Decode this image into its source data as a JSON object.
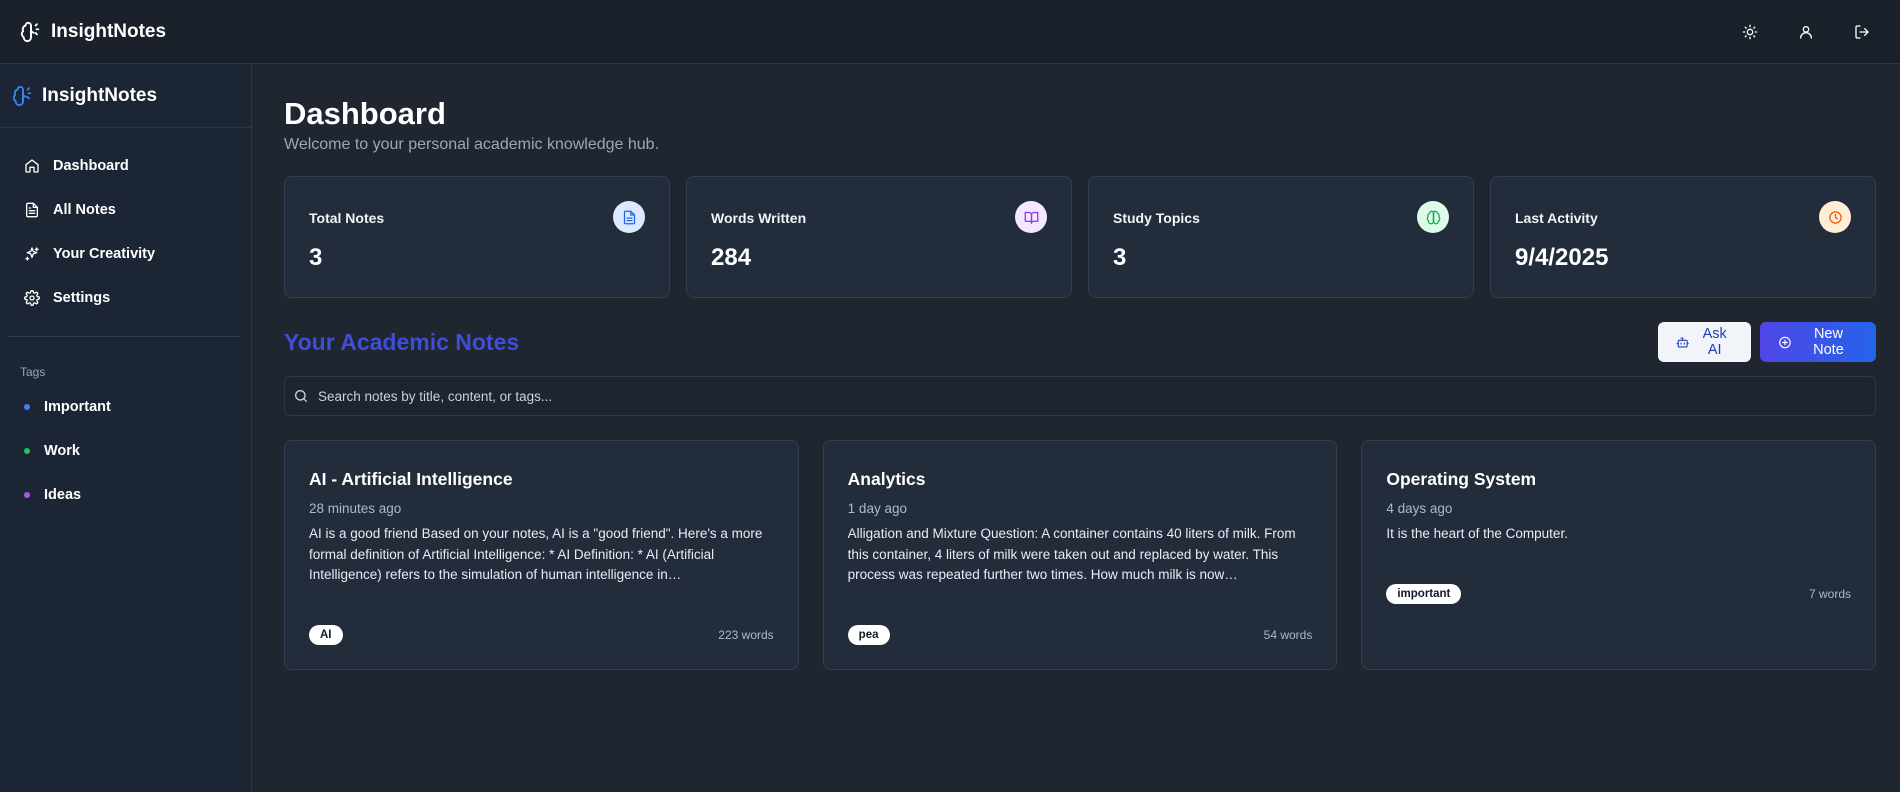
{
  "app": {
    "name": "InsightNotes"
  },
  "topbar": {
    "actions": [
      {
        "icon": "sun-icon",
        "name": "theme-toggle-button"
      },
      {
        "icon": "user-icon",
        "name": "profile-button"
      },
      {
        "icon": "logout-icon",
        "name": "logout-button"
      }
    ]
  },
  "sidebar": {
    "brand": "InsightNotes",
    "nav": [
      {
        "label": "Dashboard",
        "icon": "home-icon"
      },
      {
        "label": "All Notes",
        "icon": "file-text-icon"
      },
      {
        "label": "Your Creativity",
        "icon": "sparkles-icon"
      },
      {
        "label": "Settings",
        "icon": "gear-icon"
      }
    ],
    "tags_title": "Tags",
    "tags": [
      {
        "label": "Important",
        "color": "#3b82f6"
      },
      {
        "label": "Work",
        "color": "#22c55e"
      },
      {
        "label": "Ideas",
        "color": "#a855f7"
      }
    ]
  },
  "dashboard": {
    "title": "Dashboard",
    "subtitle": "Welcome to your personal academic knowledge hub.",
    "stats": [
      {
        "label": "Total Notes",
        "value": "3",
        "icon": "file-text-icon",
        "icon_bg": "#dbeafe",
        "icon_color": "#2563eb"
      },
      {
        "label": "Words Written",
        "value": "284",
        "icon": "book-open-icon",
        "icon_bg": "#f3e8ff",
        "icon_color": "#9333ea"
      },
      {
        "label": "Study Topics",
        "value": "3",
        "icon": "brain-icon",
        "icon_bg": "#dcfce7",
        "icon_color": "#16a34a"
      },
      {
        "label": "Last Activity",
        "value": "9/4/2025",
        "icon": "clock-icon",
        "icon_bg": "#ffedd5",
        "icon_color": "#ea580c"
      }
    ]
  },
  "notes_section": {
    "title": "Your Academic Notes",
    "ask_ai_label": "Ask AI",
    "new_note_label": "New Note",
    "search_placeholder": "Search notes by title, content, or tags..."
  },
  "notes": [
    {
      "title": "AI - Artificial Intelligence",
      "time": "28 minutes ago",
      "body": "AI is a good friend Based on your notes, AI is a \"good friend\". Here's a more formal definition of Artificial Intelligence: * AI Definition: * AI (Artificial Intelligence) refers to the simulation of human intelligence in…",
      "tag": "AI",
      "words": "223 words"
    },
    {
      "title": "Analytics",
      "time": "1 day ago",
      "body": "Alligation and Mixture Question: A container contains 40 liters of milk. From this container, 4 liters of milk were taken out and replaced by water. This process was repeated further two times. How much milk is now…",
      "tag": "pea",
      "words": "54 words"
    },
    {
      "title": "Operating System",
      "time": "4 days ago",
      "body": "It is the heart of the Computer.",
      "tag": "important",
      "words": "7 words"
    }
  ]
}
